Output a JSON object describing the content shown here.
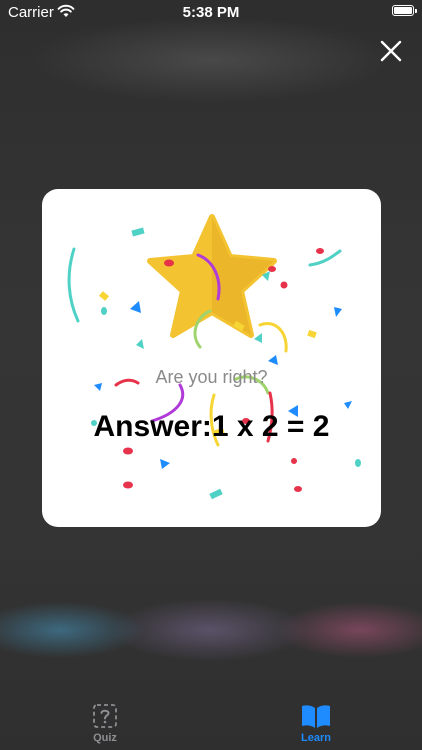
{
  "status_bar": {
    "carrier": "Carrier",
    "time": "5:38 PM"
  },
  "icons": {
    "close": "close-icon",
    "star": "star-icon",
    "quiz": "question-mark-box-icon",
    "learn": "open-book-icon",
    "wifi": "wifi-icon",
    "battery": "battery-icon"
  },
  "dialog": {
    "question": "Are you right?",
    "answer_label": "Answer:",
    "answer_value": "1 x 2 = 2"
  },
  "tabs": [
    {
      "label": "Quiz",
      "selected": false
    },
    {
      "label": "Learn",
      "selected": true
    }
  ],
  "colors": {
    "star": "#f3c331",
    "tab_selected": "#1e8bff",
    "tab_unselected": "#8e8e93"
  }
}
